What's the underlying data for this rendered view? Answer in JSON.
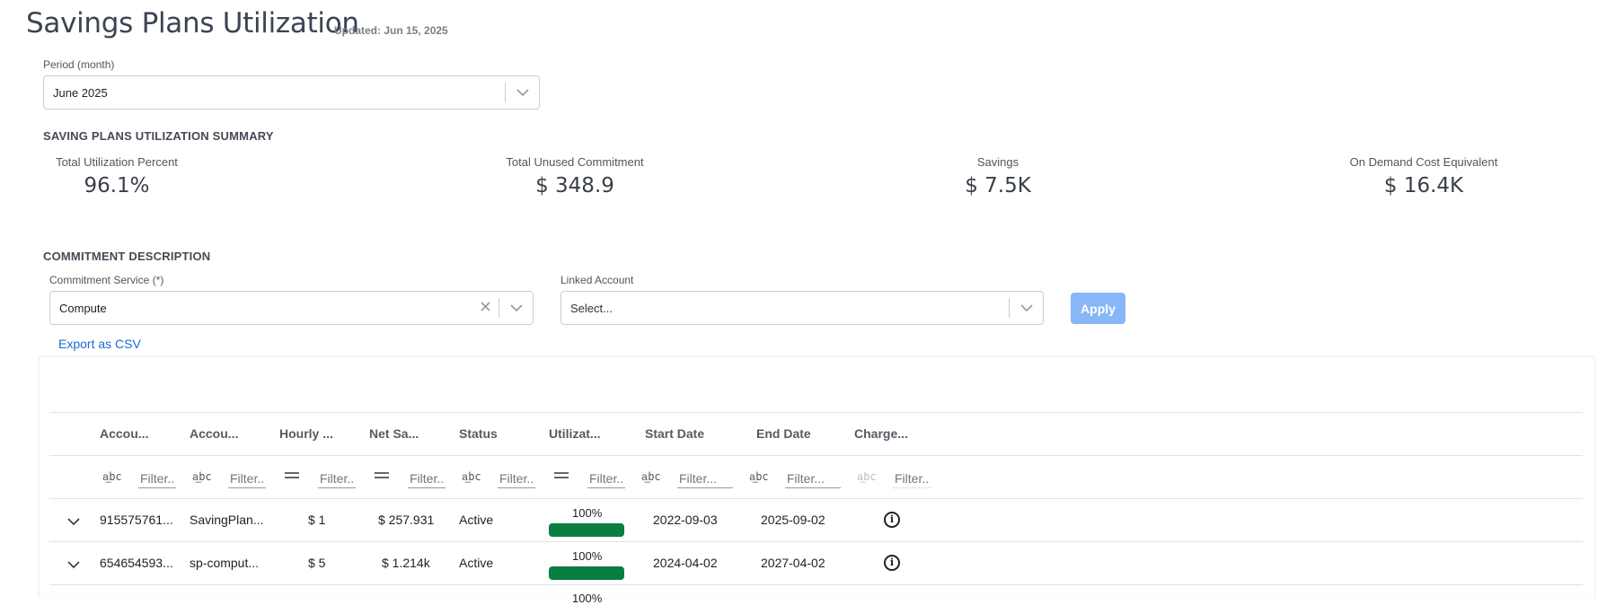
{
  "page": {
    "title": "Savings Plans Utilization",
    "updated": "Updated: Jun 15, 2025"
  },
  "period": {
    "label": "Period (month)",
    "value": "June 2025"
  },
  "summary": {
    "heading": "SAVING PLANS UTILIZATION SUMMARY",
    "kpis": [
      {
        "label": "Total Utilization Percent",
        "value": "96.1%"
      },
      {
        "label": "Total Unused Commitment",
        "value": "$ 348.9"
      },
      {
        "label": "Savings",
        "value": "$ 7.5K"
      },
      {
        "label": "On Demand Cost Equivalent",
        "value": "$ 16.4K"
      }
    ]
  },
  "commitment": {
    "heading": "COMMITMENT DESCRIPTION",
    "service_label": "Commitment Service (*)",
    "service_value": "Compute",
    "linked_label": "Linked Account",
    "linked_placeholder": "Select...",
    "apply_label": "Apply",
    "export_label": "Export as CSV"
  },
  "table": {
    "columns": [
      "Accou...",
      "Accou...",
      "Hourly ...",
      "Net Sa...",
      "Status",
      "Utilizat...",
      "Start Date",
      "End Date",
      "Charge..."
    ],
    "filter_placeholder": "Filter...",
    "filter_icons": {
      "text": "a͟bc",
      "number": "="
    },
    "rows": [
      {
        "account_id": "915575761...",
        "account_name": "SavingPlan...",
        "hourly": "$ 1",
        "net_savings": "$ 257.931",
        "status": "Active",
        "utilization_label": "100%",
        "utilization": 1.0,
        "start": "2022-09-03",
        "end": "2025-09-02"
      },
      {
        "account_id": "654654593...",
        "account_name": "sp-comput...",
        "hourly": "$ 5",
        "net_savings": "$ 1.214k",
        "status": "Active",
        "utilization_label": "100%",
        "utilization": 1.0,
        "start": "2024-04-02",
        "end": "2027-04-02"
      },
      {
        "account_id": "",
        "account_name": "",
        "hourly": "",
        "net_savings": "",
        "status": "",
        "utilization_label": "100%",
        "utilization": 1.0,
        "start": "",
        "end": ""
      }
    ]
  },
  "colors": {
    "accent": "#1b6ad2",
    "apply_bg": "#88b7f7",
    "util_bar": "#0a7d41"
  },
  "icons": {
    "chevron": "chevron-down-icon",
    "clear": "clear-icon",
    "info": "info-icon",
    "expand": "expand-row-icon"
  }
}
